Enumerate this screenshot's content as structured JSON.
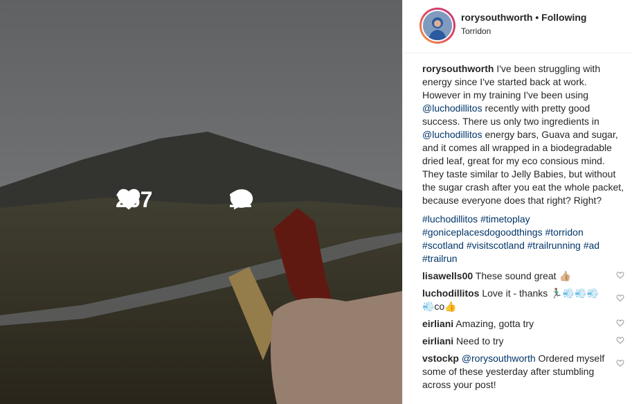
{
  "photo": {
    "likes": "267",
    "comments_count": "11"
  },
  "header": {
    "username": "rorysouthworth",
    "separator": "•",
    "follow_status": "Following",
    "location": "Torridon"
  },
  "caption": {
    "username": "rorysouthworth",
    "part1": " I've been struggling with energy since I've started back at work. However in my training I've been using ",
    "mention1": "@luchodillitos",
    "part2": " recently with pretty good success. There us only two ingredients in ",
    "mention2": "@luchodillitos",
    "part3": " energy bars, Guava and sugar, and it comes all wrapped in a biodegradable dried leaf, great for my eco consious mind. They taste similar to Jelly Babies, but without the sugar crash after you eat the whole packet, because everyone does that right? Right?",
    "hashtags": [
      "#luchodillitos",
      "#timetoplay",
      "#goniceplacesdogoodthings",
      "#torridon",
      "#scotland",
      "#visitscotland",
      "#trailrunning",
      "#ad",
      "#trailrun"
    ]
  },
  "comments": [
    {
      "user": "lisawells00",
      "text": " These sound great 👍🏼"
    },
    {
      "user": "luchodillitos",
      "text": " Love it - thanks 🏃🏽‍♂️💨💨💨💨co👍"
    },
    {
      "user": "eirliani",
      "text": " Amazing, gotta try"
    },
    {
      "user": "eirliani",
      "text": " Need to try"
    },
    {
      "user": "vstockp",
      "mention": "@rorysouthworth",
      "text": " Ordered myself some of these yesterday after stumbling across your post!"
    }
  ]
}
